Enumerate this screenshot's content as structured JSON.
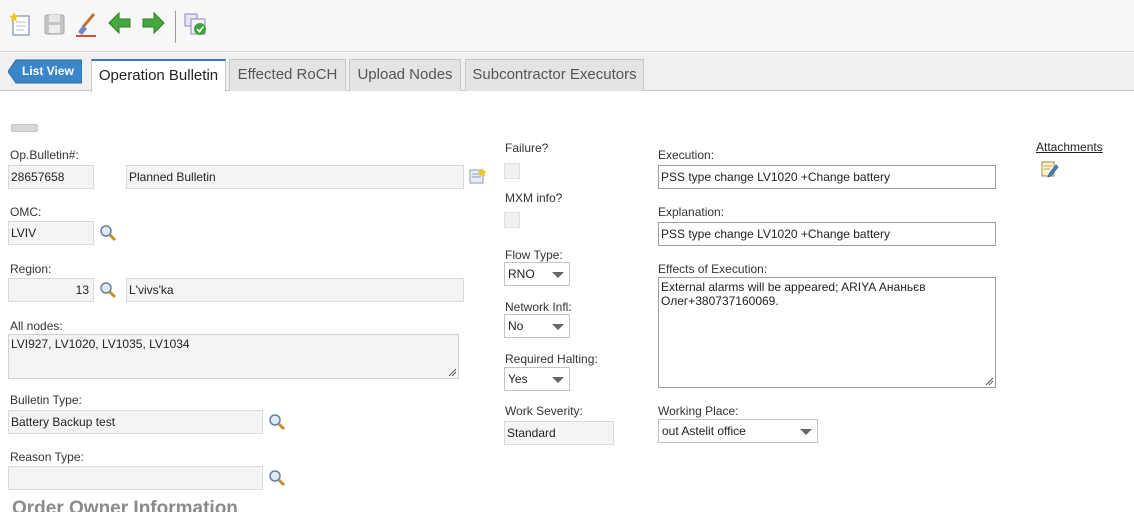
{
  "toolbar": {
    "buttons": [
      "new-icon",
      "save-icon",
      "clear-icon",
      "back-arrow-icon",
      "forward-arrow-icon",
      "approve-icon"
    ]
  },
  "nav": {
    "list_view": "List View",
    "tabs": [
      "Operation Bulletin",
      "Effected RoCH",
      "Upload Nodes",
      "Subcontractor Executors"
    ]
  },
  "form": {
    "op_bulletin_label": "Op.Bulletin#:",
    "op_bulletin_value": "28657658",
    "op_bulletin_status": "Planned Bulletin",
    "omc_label": "OMC:",
    "omc_value": "LVIV",
    "region_label": "Region:",
    "region_code": "13",
    "region_name": "L'vivs'ka",
    "all_nodes_label": "All nodes:",
    "all_nodes_value": "LVI927, LV1020, LV1035, LV1034",
    "bulletin_type_label": "Bulletin Type:",
    "bulletin_type_value": "Battery Backup test",
    "reason_type_label": "Reason Type:",
    "reason_type_value": "",
    "failure_label": "Failure?",
    "mxm_label": "MXM info?",
    "flow_type_label": "Flow Type:",
    "flow_type_value": "RNO",
    "network_infl_label": "Network Infl:",
    "network_infl_value": "No",
    "required_halting_label": "Required Halting:",
    "required_halting_value": "Yes",
    "work_severity_label": "Work Severity:",
    "work_severity_value": "Standard",
    "execution_label": "Execution:",
    "execution_value": "PSS type change LV1020 +Change battery",
    "explanation_label": "Explanation:",
    "explanation_value": "PSS type change LV1020 +Change battery",
    "effects_label": "Effects of Execution:",
    "effects_value": "External alarms will be appeared; ARIYA Ананьєв Олег+380737160069.",
    "working_place_label": "Working Place:",
    "working_place_value": "out Astelit office",
    "attachments_label": "Attachments"
  },
  "section": {
    "order_owner_title": "Order Owner Information"
  },
  "colors": {
    "accent": "#3b7ab8",
    "list_view_bg": "#3a86c8",
    "icon_green": "#3aa53a"
  }
}
